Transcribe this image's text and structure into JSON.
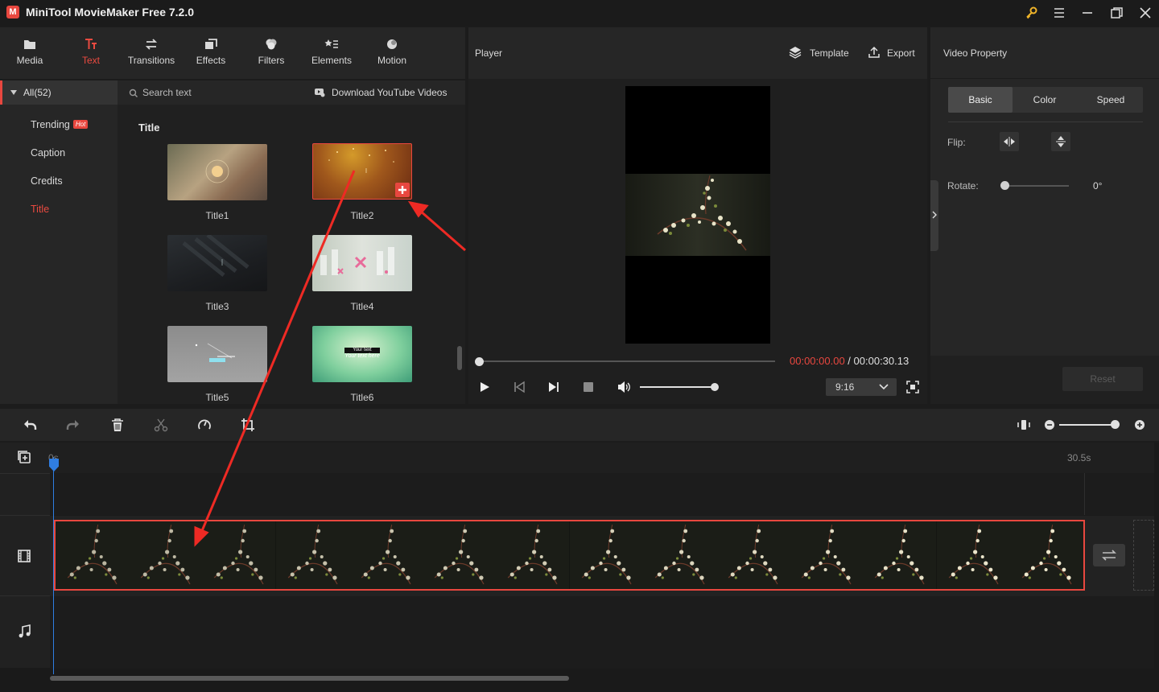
{
  "window": {
    "title": "MiniTool MovieMaker Free 7.2.0"
  },
  "toolbar": {
    "tabs": [
      {
        "label": "Media",
        "icon": "folder-icon"
      },
      {
        "label": "Text",
        "icon": "text-icon"
      },
      {
        "label": "Transitions",
        "icon": "transitions-icon"
      },
      {
        "label": "Effects",
        "icon": "effects-icon"
      },
      {
        "label": "Filters",
        "icon": "filters-icon"
      },
      {
        "label": "Elements",
        "icon": "elements-icon"
      },
      {
        "label": "Motion",
        "icon": "motion-icon"
      }
    ],
    "active": "Text"
  },
  "categories": {
    "all_label": "All(52)",
    "items": [
      {
        "label": "Trending",
        "badge": "Hot"
      },
      {
        "label": "Caption"
      },
      {
        "label": "Credits"
      },
      {
        "label": "Title"
      }
    ],
    "active": "Title"
  },
  "library": {
    "search_placeholder": "Search text",
    "download_label": "Download YouTube Videos",
    "heading": "Title",
    "items": [
      {
        "label": "Title1"
      },
      {
        "label": "Title2"
      },
      {
        "label": "Title3"
      },
      {
        "label": "Title4"
      },
      {
        "label": "Title5"
      },
      {
        "label": "Title6",
        "text_line1": "Your text",
        "text_line2": "Your text here"
      }
    ]
  },
  "player": {
    "title": "Player",
    "template_label": "Template",
    "export_label": "Export",
    "current_time": "00:00:00.00",
    "separator": " / ",
    "total_time": "00:00:30.13",
    "aspect_ratio": "9:16",
    "progress": 0,
    "volume": 1.0
  },
  "property": {
    "title": "Video Property",
    "tabs": [
      "Basic",
      "Color",
      "Speed"
    ],
    "active_tab": "Basic",
    "flip_label": "Flip:",
    "rotate_label": "Rotate:",
    "rotate_value": "0°",
    "reset_label": "Reset"
  },
  "timeline": {
    "start_label": "0s",
    "end_label": "30.5s",
    "zoom": 0.95,
    "clip_frames": 14
  },
  "colors": {
    "accent": "#e8473f",
    "panel": "#262626",
    "background": "#1c1c1c"
  }
}
